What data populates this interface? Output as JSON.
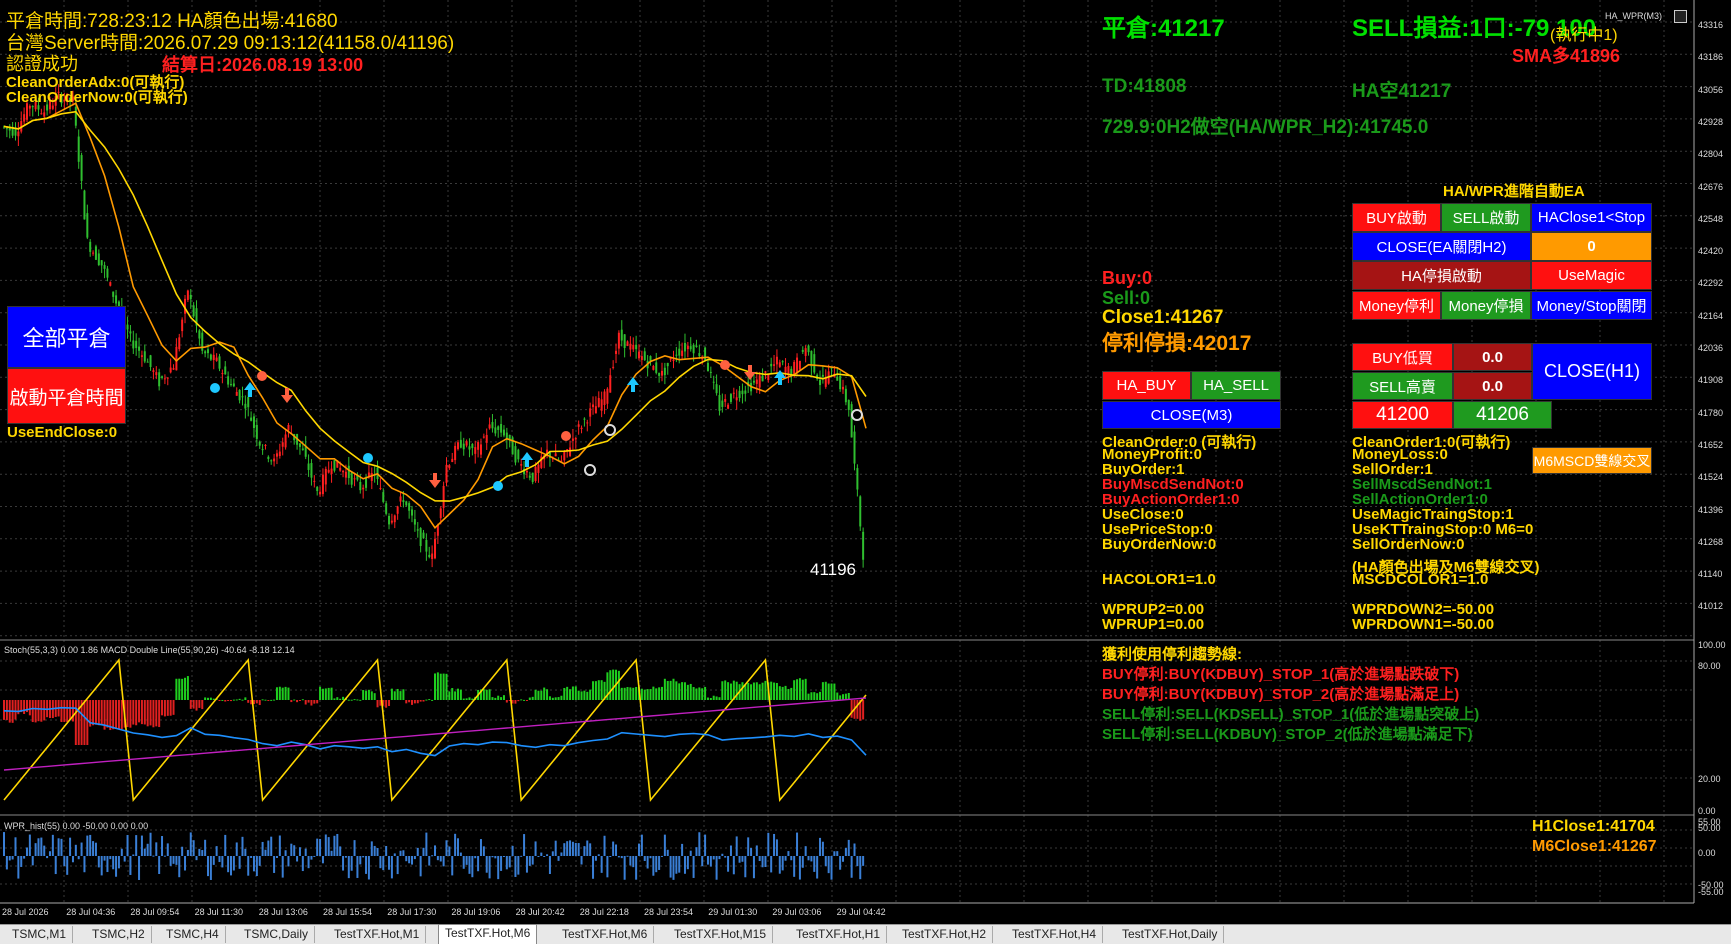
{
  "header": {
    "line1": "平倉時間:728:23:12 HA顏色出場:41680",
    "line2": "台灣Server時間:2026.07.29 09:13:12(41158.0/41196)",
    "auth": "認證成功",
    "expiry": "結算日:2026.08.19 13:00",
    "clean_adx": "CleanOrderAdx:0(可執行)",
    "clean_now": "CleanOrderNow:0(可執行)"
  },
  "top_right": {
    "close_price": "平倉:41217",
    "sell_status": "SELL損益:1口:-79 100",
    "exec": "(執行中1)",
    "sma": "SMA多41896",
    "td": "TD:41808",
    "ha_empty": "HA空41217",
    "h2line": "729.9:0H2做空(HA/WPR_H2):41745.0",
    "symbol_label": "HA_WPR(M3)"
  },
  "left_buttons": {
    "close_all": "全部平倉",
    "start_close_time": "啟動平倉時間",
    "use_end_close": "UseEndClose:0"
  },
  "mid_status": {
    "buy": "Buy:0",
    "sell": "Sell:0",
    "close1": "Close1:41267",
    "stop_profit": "停利停損:42017"
  },
  "mid_buttons": {
    "ha_buy": "HA_BUY",
    "ha_sell": "HA_SELL",
    "close_m3": "CLOSE(M3)"
  },
  "ea_panel": {
    "title": "HA/WPR進階自動EA",
    "buy_start": "BUY啟動",
    "sell_start": "SELL啟動",
    "haclose": "HAClose1<Stop",
    "close_ea": "CLOSE(EA關閉H2)",
    "zero": "0",
    "ha_stop": "HA停損啟動",
    "use_magic": "UseMagic",
    "money_profit": "Money停利",
    "money_stop": "Money停損",
    "money_close": "Money/Stop關閉",
    "buy_low": "BUY低買",
    "buy_low_val": "0.0",
    "sell_high": "SELL高賣",
    "sell_high_val": "0.0",
    "close_h1": "CLOSE(H1)",
    "price_a": "41200",
    "price_b": "41206",
    "m6_cross": "M6MSCD雙線交叉"
  },
  "left_info": [
    "CleanOrder:0 (可執行)",
    "MoneyProfit:0",
    "BuyOrder:1",
    "BuyMscdSendNot:0",
    "BuyActionOrder1:0",
    "UseClose:0",
    "UsePriceStop:0",
    "BuyOrderNow:0",
    "HACOLOR1=1.0",
    "WPRUP2=0.00",
    "WPRUP1=0.00"
  ],
  "right_info": [
    "CleanOrder1:0(可執行)",
    "MoneyLoss:0",
    "SellOrder:1",
    "SellMscdSendNot:1",
    "SellActionOrder1:0",
    "UseMagicTraingStop:1",
    "UseKTTraingStop:0  M6=0",
    "SellOrderNow:0",
    "(HA顏色出場及M6雙線交叉)",
    "MSCDCOLOR1=1.0",
    "WPRDOWN2=-50.00",
    "WPRDOWN1=-50.00"
  ],
  "trend_info": [
    "獲利使用停利趨勢線:",
    "BUY停利:BUY(KDBUY)_STOP_1(高於進場點跌破下)",
    "BUY停利:BUY(KDBUY)_STOP_2(高於進場點滿足上)",
    "SELL停利:SELL(KDSELL)_STOP_1(低於進場點突破上)",
    "SELL停利:SELL(KDBUY)_STOP_2(低於進場點滿足下)"
  ],
  "bottom_right": {
    "h1close": "H1Close1:41704",
    "m6close": "M6Close1:41267"
  },
  "chart_price_label": "41196",
  "sub1_label": "Stoch(55,3,3) 0.00 1.86 MACD Double Line(55,90,26) -40.64 -8.18 12.14",
  "sub2_label": "WPR_hist(55) 0.00 -50.00 0.00 0.00",
  "price_axis": [
    "43316",
    "43186",
    "43056",
    "42928",
    "42804",
    "42676",
    "42548",
    "42420",
    "42292",
    "42164",
    "42036",
    "41908",
    "41780",
    "41652",
    "41524",
    "41396",
    "41268",
    "41140",
    "41012"
  ],
  "osc_axis": [
    "100.00",
    "80.00",
    "20.00",
    "0.00"
  ],
  "wpr_axis": [
    "55.00",
    "50.00",
    "0.00",
    "-50.00",
    "-55.00"
  ],
  "time_axis": [
    "28 Jul 2026",
    "28 Jul 04:36",
    "28 Jul 09:54",
    "28 Jul 11:30",
    "28 Jul 13:06",
    "28 Jul 15:54",
    "28 Jul 17:30",
    "28 Jul 19:06",
    "28 Jul 20:42",
    "28 Jul 22:18",
    "28 Jul 23:54",
    "29 Jul 01:30",
    "29 Jul 03:06",
    "29 Jul 04:42"
  ],
  "tabs": [
    "TSMC,M1",
    "TSMC,H2",
    "TSMC,H4",
    "TSMC,Daily",
    "TestTXF.Hot,M1",
    "TestTXF.Hot,M6",
    "TestTXF.Hot,M6",
    "TestTXF.Hot,M15",
    "TestTXF.Hot,H1",
    "TestTXF.Hot,H2",
    "TestTXF.Hot,H4",
    "TestTXF.Hot,Daily"
  ],
  "active_tab": 5,
  "chart_data": {
    "type": "line",
    "title": "",
    "price_series": [
      {
        "values": [
          42900,
          42880,
          42990,
          42960,
          43020,
          43000,
          42440,
          42350,
          42200,
          42050,
          41980,
          41880,
          41950,
          42250,
          42000,
          41960,
          41870,
          41800,
          41640,
          41560,
          41700,
          41600,
          41440,
          41560,
          41520,
          41460,
          41520,
          41330,
          41420,
          41270,
          41180,
          41550,
          41640,
          41600,
          41700,
          41680,
          41560,
          41500,
          41600,
          41560,
          41680,
          41760,
          41820,
          42060,
          42010,
          41960,
          41910,
          42000,
          42030,
          41980,
          41780,
          41830,
          41860,
          41900,
          41960,
          41920,
          42020,
          41880,
          41930,
          41780,
          41196
        ]
      }
    ],
    "ylim": [
      41012,
      43316
    ]
  }
}
